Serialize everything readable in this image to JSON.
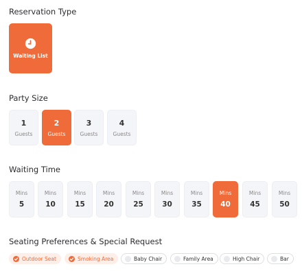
{
  "reservation": {
    "title": "Reservation Type",
    "option_label": "Waiting List",
    "option_icon": "clock-icon"
  },
  "party": {
    "title": "Party Size",
    "unit": "Guests",
    "options": [
      "1",
      "2",
      "3",
      "4"
    ],
    "selected": "2"
  },
  "waiting": {
    "title": "Waiting Time",
    "unit": "Mins",
    "options": [
      "5",
      "10",
      "15",
      "20",
      "25",
      "30",
      "35",
      "40",
      "45",
      "50"
    ],
    "selected": "40"
  },
  "seating": {
    "title": "Seating Preferences & Special Request",
    "chips": [
      {
        "label": "Outdoor Seat",
        "selected": true
      },
      {
        "label": "Smoking Area",
        "selected": true
      },
      {
        "label": "Baby Chair",
        "selected": false
      },
      {
        "label": "Family Area",
        "selected": false
      },
      {
        "label": "High Chair",
        "selected": false
      },
      {
        "label": "Bar",
        "selected": false
      }
    ]
  },
  "colors": {
    "accent": "#ef6b3a",
    "card_bg": "#f4f5f8",
    "chip_selected_bg": "#fdeee7"
  }
}
